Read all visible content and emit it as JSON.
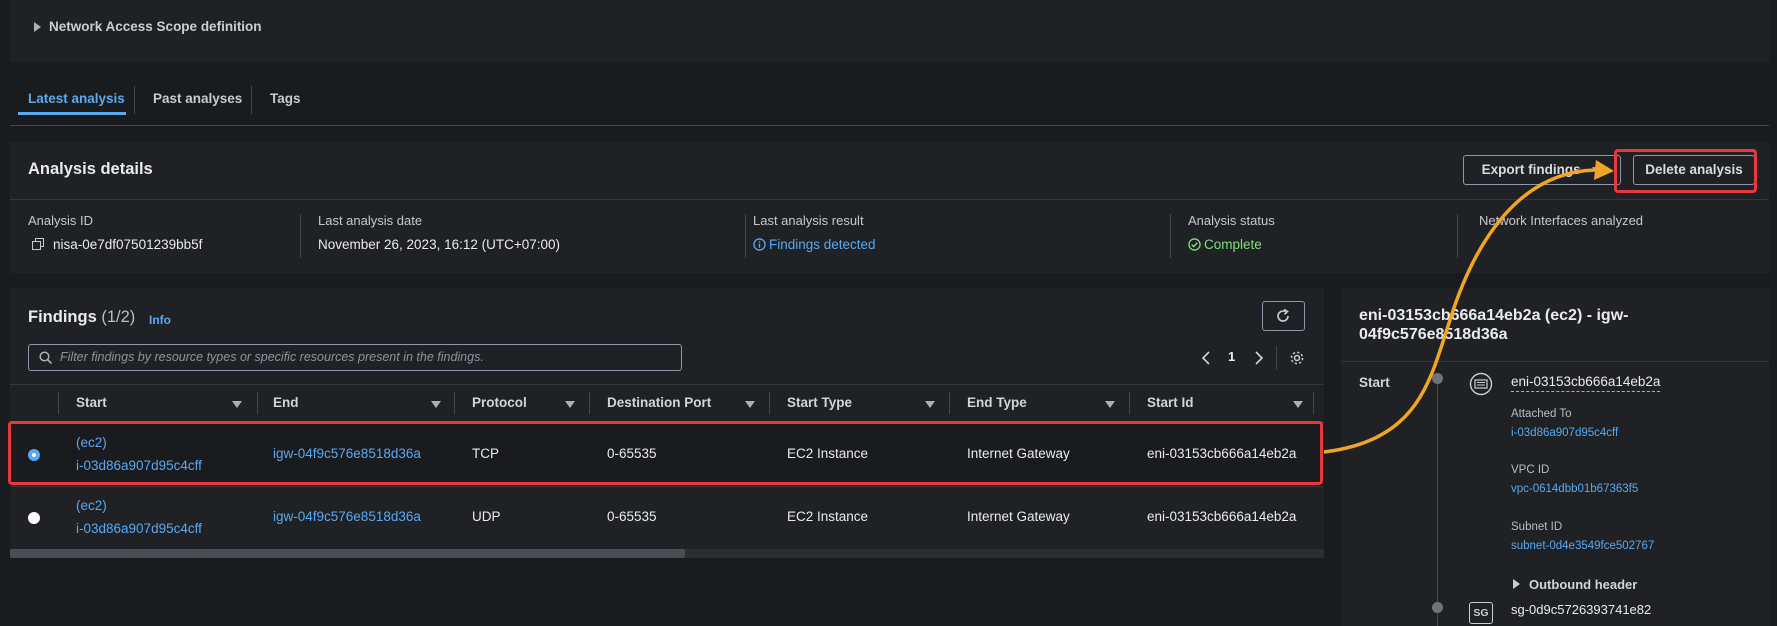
{
  "scope": {
    "label": "Network Access Scope definition"
  },
  "tabs": [
    {
      "label": "Latest analysis"
    },
    {
      "label": "Past analyses"
    },
    {
      "label": "Tags"
    }
  ],
  "details": {
    "title": "Analysis details",
    "export_label": "Export findings",
    "delete_label": "Delete analysis",
    "fields": {
      "analysis_id": {
        "label": "Analysis ID",
        "value": "nisa-0e7df07501239bb5f"
      },
      "last_date": {
        "label": "Last analysis date",
        "value": "November 26, 2023, 16:12 (UTC+07:00)"
      },
      "last_result": {
        "label": "Last analysis result",
        "value": "Findings detected"
      },
      "status": {
        "label": "Analysis status",
        "value": "Complete"
      },
      "interfaces": {
        "label": "Network Interfaces analyzed"
      }
    }
  },
  "findings": {
    "title": "Findings",
    "count": "(1/2)",
    "info": "Info",
    "search_placeholder": "Filter findings by resource types or specific resources present in the findings.",
    "page": "1",
    "columns": [
      "Start",
      "End",
      "Protocol",
      "Destination Port",
      "Start Type",
      "End Type",
      "Start Id"
    ],
    "rows": [
      {
        "selected": true,
        "start_type_tag": "(ec2)",
        "start": "i-03d86a907d95c4cff",
        "end": "igw-04f9c576e8518d36a",
        "protocol": "TCP",
        "port": "0-65535",
        "start_type": "EC2 Instance",
        "end_type": "Internet Gateway",
        "start_id": "eni-03153cb666a14eb2a"
      },
      {
        "selected": false,
        "start_type_tag": "(ec2)",
        "start": "i-03d86a907d95c4cff",
        "end": "igw-04f9c576e8518d36a",
        "protocol": "UDP",
        "port": "0-65535",
        "start_type": "EC2 Instance",
        "end_type": "Internet Gateway",
        "start_id": "eni-03153cb666a14eb2a"
      }
    ]
  },
  "side": {
    "title": "eni-03153cb666a14eb2a (ec2) - igw-04f9c576e8518d36a",
    "start_label": "Start",
    "eni": "eni-03153cb666a14eb2a",
    "attached_label": "Attached To",
    "attached_value": "i-03d86a907d95c4cff",
    "vpc_label": "VPC ID",
    "vpc_value": "vpc-0614dbb01b67363f5",
    "subnet_label": "Subnet ID",
    "subnet_value": "subnet-0d4e3549fce502767",
    "outbound_label": "Outbound header",
    "sg_badge": "SG",
    "sg_value": "sg-0d9c5726393741e82"
  },
  "colors": {
    "link": "#58a9f2",
    "success": "#7ee07b",
    "highlight": "#e8383d",
    "arrow": "#f0a524"
  }
}
